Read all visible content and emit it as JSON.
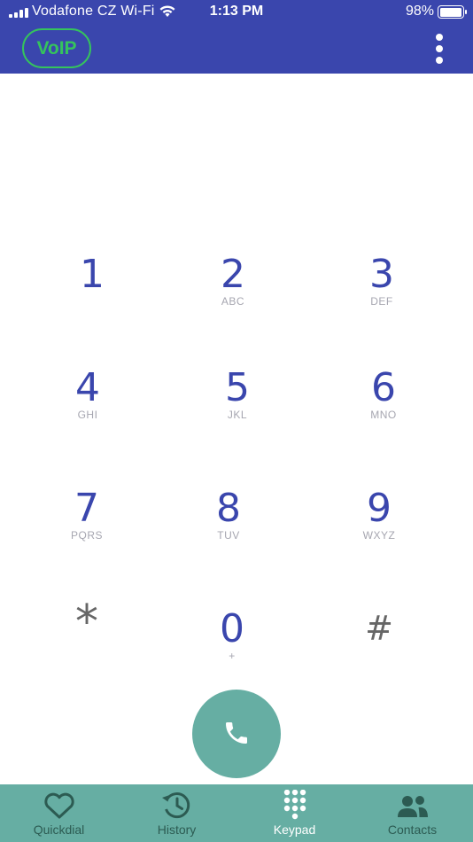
{
  "status_bar": {
    "carrier": "Vodafone CZ Wi-Fi",
    "time": "1:13 PM",
    "battery": "98%",
    "battery_level": 0.98
  },
  "app_bar": {
    "badge": "VoIP",
    "menu_icon": "more-vert-icon"
  },
  "keypad": {
    "keys": [
      {
        "digit": "1",
        "letters": ""
      },
      {
        "digit": "2",
        "letters": "ABC"
      },
      {
        "digit": "3",
        "letters": "DEF"
      },
      {
        "digit": "4",
        "letters": "GHI"
      },
      {
        "digit": "5",
        "letters": "JKL"
      },
      {
        "digit": "6",
        "letters": "MNO"
      },
      {
        "digit": "7",
        "letters": "PQRS"
      },
      {
        "digit": "8",
        "letters": "TUV"
      },
      {
        "digit": "9",
        "letters": "WXYZ"
      },
      {
        "digit": "*",
        "letters": ""
      },
      {
        "digit": "0",
        "letters": "+"
      },
      {
        "digit": "#",
        "letters": ""
      }
    ],
    "call_icon": "phone-icon"
  },
  "tabs": [
    {
      "label": "Quickdial",
      "icon": "heart-icon",
      "active": false
    },
    {
      "label": "History",
      "icon": "history-icon",
      "active": false
    },
    {
      "label": "Keypad",
      "icon": "dialpad-icon",
      "active": true
    },
    {
      "label": "Contacts",
      "icon": "contacts-icon",
      "active": false
    }
  ],
  "colors": {
    "primary": "#3a46ad",
    "teal": "#66aea3",
    "badge_green": "#35c45c",
    "tab_inactive": "#2c5b52",
    "letters_grey": "#a6a6b0"
  }
}
